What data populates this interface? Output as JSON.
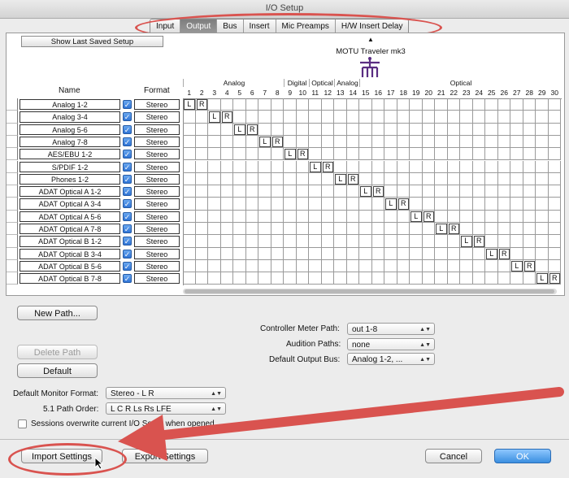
{
  "window": {
    "title": "I/O Setup"
  },
  "tabs": [
    "Input",
    "Output",
    "Bus",
    "Insert",
    "Mic Preamps",
    "H/W Insert Delay"
  ],
  "active_tab": "Output",
  "top": {
    "show_last_saved": "Show Last Saved Setup",
    "device_name": "MOTU Traveler mk3",
    "scroll_up": "▲"
  },
  "columns": {
    "name_header": "Name",
    "format_header": "Format"
  },
  "groups": [
    "Analog",
    "Digital",
    "Optical",
    "Analog",
    "Optical"
  ],
  "channel_numbers": [
    "1",
    "2",
    "3",
    "4",
    "5",
    "6",
    "7",
    "8",
    "9",
    "10",
    "11",
    "12",
    "13",
    "14",
    "15",
    "16",
    "17",
    "18",
    "19",
    "20",
    "21",
    "22",
    "23",
    "24",
    "25",
    "26",
    "27",
    "28",
    "29",
    "30"
  ],
  "rows": [
    {
      "name": "Analog 1-2",
      "format": "Stereo"
    },
    {
      "name": "Analog 3-4",
      "format": "Stereo"
    },
    {
      "name": "Analog 5-6",
      "format": "Stereo"
    },
    {
      "name": "Analog 7-8",
      "format": "Stereo"
    },
    {
      "name": "AES/EBU 1-2",
      "format": "Stereo"
    },
    {
      "name": "S/PDIF 1-2",
      "format": "Stereo"
    },
    {
      "name": "Phones 1-2",
      "format": "Stereo"
    },
    {
      "name": "ADAT Optical A 1-2",
      "format": "Stereo"
    },
    {
      "name": "ADAT Optical A 3-4",
      "format": "Stereo"
    },
    {
      "name": "ADAT Optical A 5-6",
      "format": "Stereo"
    },
    {
      "name": "ADAT Optical A 7-8",
      "format": "Stereo"
    },
    {
      "name": "ADAT Optical B 1-2",
      "format": "Stereo"
    },
    {
      "name": "ADAT Optical B 3-4",
      "format": "Stereo"
    },
    {
      "name": "ADAT Optical B 5-6",
      "format": "Stereo"
    },
    {
      "name": "ADAT Optical B 7-8",
      "format": "Stereo"
    }
  ],
  "lr_labels": [
    "L",
    "R"
  ],
  "buttons": {
    "new_path": "New Path...",
    "delete_path": "Delete Path",
    "default": "Default",
    "import": "Import Settings",
    "export": "Export Settings",
    "cancel": "Cancel",
    "ok": "OK"
  },
  "settings": {
    "controller_meter_label": "Controller Meter Path:",
    "controller_meter_value": "out 1-8",
    "audition_label": "Audition Paths:",
    "audition_value": "none",
    "default_output_label": "Default Output Bus:",
    "default_output_value": "Analog 1-2, ...",
    "monitor_format_label": "Default Monitor Format:",
    "monitor_format_value": "Stereo - L R",
    "path_order_label": "5.1 Path Order:",
    "path_order_value": "L C R Ls Rs LFE",
    "sessions_overwrite": "Sessions overwrite current I/O Setup when opened"
  },
  "accent_colors": {
    "annotation_red": "#d9534f",
    "ok_blue": "#3b8fe0"
  }
}
